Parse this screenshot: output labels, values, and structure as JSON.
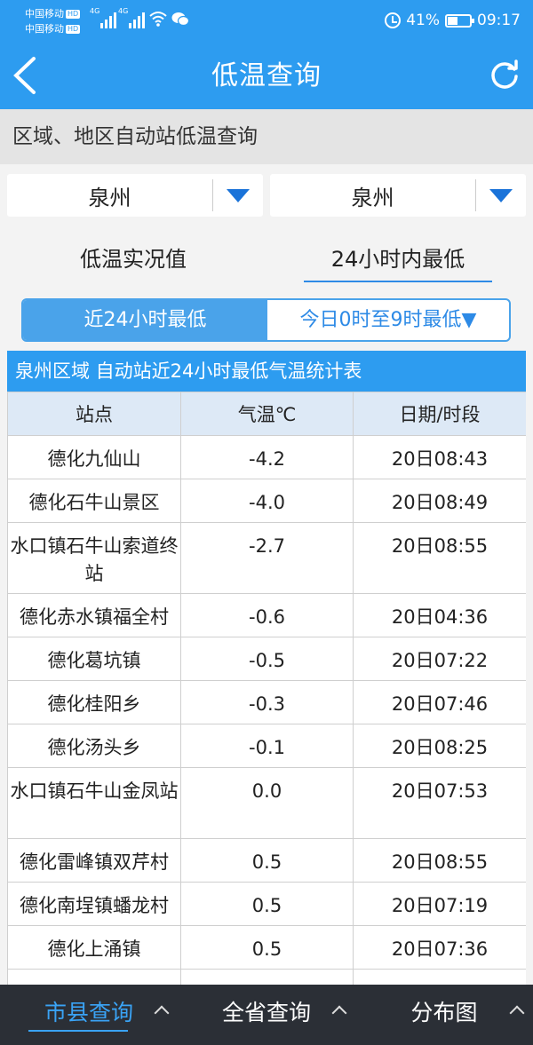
{
  "status_bar": {
    "carrier1": "中国移动",
    "carrier2": "中国移动",
    "hd_badge": "HD",
    "net1": "4G",
    "net2": "4G",
    "battery": "41%",
    "time": "09:17"
  },
  "header": {
    "title": "低温查询",
    "back_icon": "chevron-left-icon",
    "refresh_icon": "refresh-icon"
  },
  "section": {
    "title": "区域、地区自动站低温查询"
  },
  "filters": {
    "region": "泉州",
    "area": "泉州"
  },
  "tabs": [
    {
      "label": "低温实况值",
      "active": false
    },
    {
      "label": "24小时内最低",
      "active": true
    }
  ],
  "segment": [
    {
      "label": "近24小时最低",
      "active": true
    },
    {
      "label": "今日0时至9时最低▼",
      "active": false
    }
  ],
  "table": {
    "caption": "泉州区域 自动站近24小时最低气温统计表",
    "headers": [
      "站点",
      "气温℃",
      "日期/时段"
    ],
    "rows": [
      {
        "station": "德化九仙山",
        "temp": "-4.2",
        "time": "20日08:43"
      },
      {
        "station": "德化石牛山景区",
        "temp": "-4.0",
        "time": "20日08:49"
      },
      {
        "station": "水口镇石牛山索道终站",
        "temp": "-2.7",
        "time": "20日08:55"
      },
      {
        "station": "德化赤水镇福全村",
        "temp": "-0.6",
        "time": "20日04:36"
      },
      {
        "station": "德化葛坑镇",
        "temp": "-0.5",
        "time": "20日07:22"
      },
      {
        "station": "德化桂阳乡",
        "temp": "-0.3",
        "time": "20日07:46"
      },
      {
        "station": "德化汤头乡",
        "temp": "-0.1",
        "time": "20日08:25"
      },
      {
        "station": "水口镇石牛山金凤站",
        "temp": "0.0",
        "time": "20日07:53"
      },
      {
        "station": "德化雷峰镇双芹村",
        "temp": "0.5",
        "time": "20日08:55"
      },
      {
        "station": "德化南埕镇蟠龙村",
        "temp": "0.5",
        "time": "20日07:19"
      },
      {
        "station": "德化上涌镇",
        "temp": "0.5",
        "time": "20日07:36"
      },
      {
        "station": "",
        "temp": "",
        "time": ""
      }
    ]
  },
  "bottom_nav": [
    {
      "label": "市县查询",
      "active": true
    },
    {
      "label": "全省查询",
      "active": false
    },
    {
      "label": "分布图",
      "active": false
    }
  ],
  "colors": {
    "primary": "#2d9cf0",
    "nav_bg": "#2b2f36",
    "accent": "#3aa3f5"
  }
}
